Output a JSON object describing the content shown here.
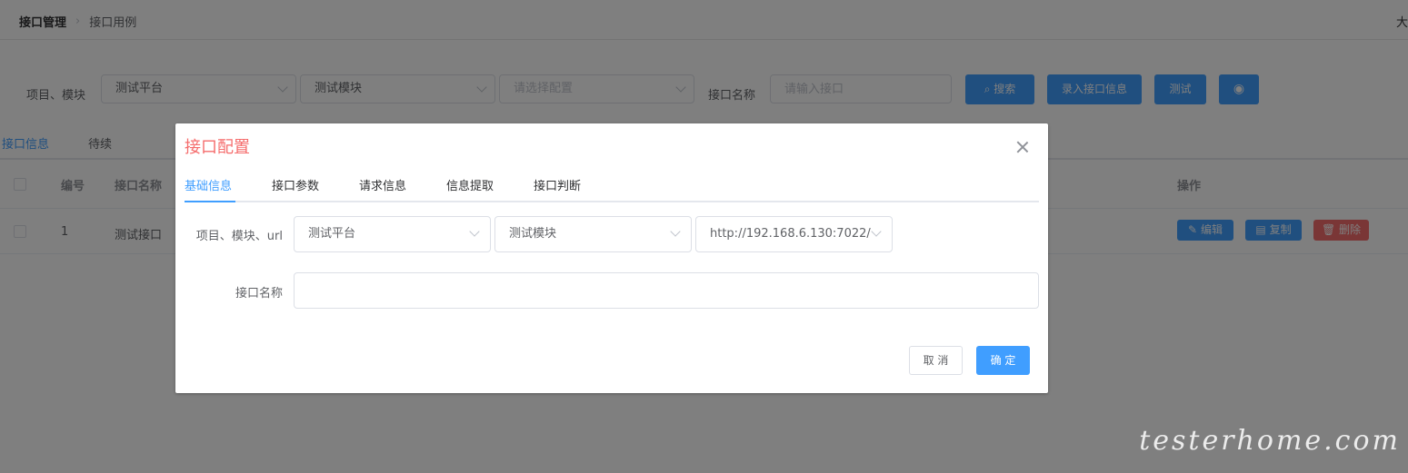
{
  "breadcrumb": {
    "root": "接口管理",
    "current": "接口用例"
  },
  "topright_text": "大",
  "filter": {
    "project_module_label": "项目、模块",
    "project_value": "测试平台",
    "module_value": "测试模块",
    "config_placeholder": "请选择配置",
    "api_name_label": "接口名称",
    "api_name_placeholder": "请输入接口",
    "search_label": "搜索",
    "enter_info_label": "录入接口信息",
    "test_label": "测试"
  },
  "page_tabs": [
    "接口信息",
    "待续"
  ],
  "table": {
    "headers": {
      "id": "编号",
      "name": "接口名称",
      "actions": "操作"
    },
    "rows": [
      {
        "id": "1",
        "name": "测试接口"
      }
    ],
    "edit_label": "编辑",
    "copy_label": "复制",
    "delete_label": "删除"
  },
  "dialog": {
    "title": "接口配置",
    "tabs": [
      "基础信息",
      "接口参数",
      "请求信息",
      "信息提取",
      "接口判断"
    ],
    "row1_label": "项目、模块、url",
    "project_value": "测试平台",
    "module_value": "测试模块",
    "url_value": "http://192.168.6.130:7022/",
    "name_label": "接口名称",
    "name_value": "",
    "cancel_label": "取 消",
    "ok_label": "确 定"
  },
  "watermark": "testerhome.com",
  "colors": {
    "primary": "#409eff",
    "danger": "#f56c6c",
    "title": "#f56c6c"
  }
}
